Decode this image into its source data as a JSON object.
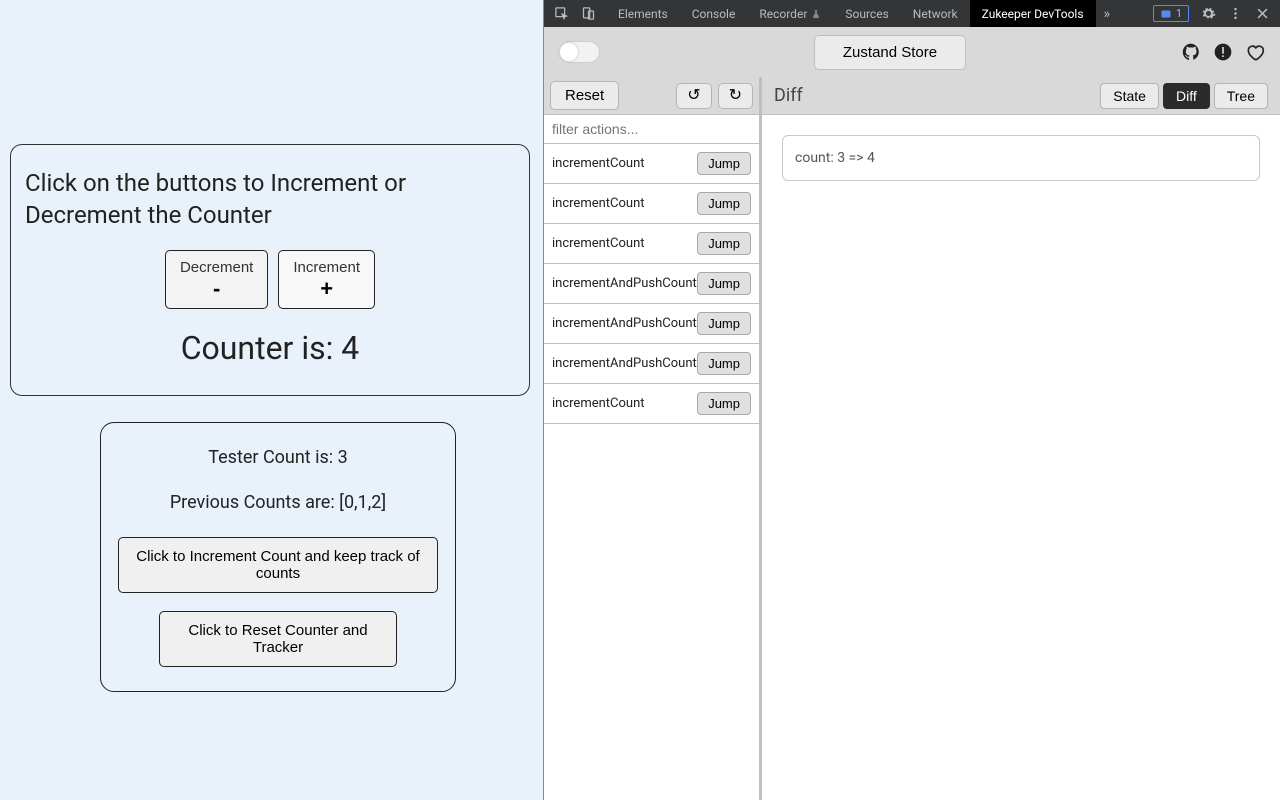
{
  "app": {
    "counter_title": "Click on the buttons to Increment or Decrement the Counter",
    "decrement_label": "Decrement",
    "decrement_symbol": "-",
    "increment_label": "Increment",
    "increment_symbol": "+",
    "counter_readout": "Counter is: 4",
    "tester_count_line": "Tester Count is: 3",
    "previous_counts_line": "Previous Counts are: [0,1,2]",
    "track_button": "Click to Increment Count and keep track of counts",
    "reset_button": "Click to Reset Counter and Tracker"
  },
  "devtools": {
    "tabs": {
      "elements": "Elements",
      "console": "Console",
      "recorder": "Recorder",
      "sources": "Sources",
      "network": "Network",
      "zukeeper": "Zukeeper DevTools"
    },
    "issues_count": "1",
    "store_button": "Zustand Store",
    "actions": {
      "reset": "Reset",
      "filter_placeholder": "filter actions...",
      "jump": "Jump",
      "list": [
        "incrementCount",
        "incrementCount",
        "incrementCount",
        "incrementAndPushCount",
        "incrementAndPushCount",
        "incrementAndPushCount",
        "incrementCount"
      ]
    },
    "diff": {
      "title": "Diff",
      "view_tabs": {
        "state": "State",
        "diff": "Diff",
        "tree": "Tree"
      },
      "content": "count: 3 => 4"
    }
  }
}
